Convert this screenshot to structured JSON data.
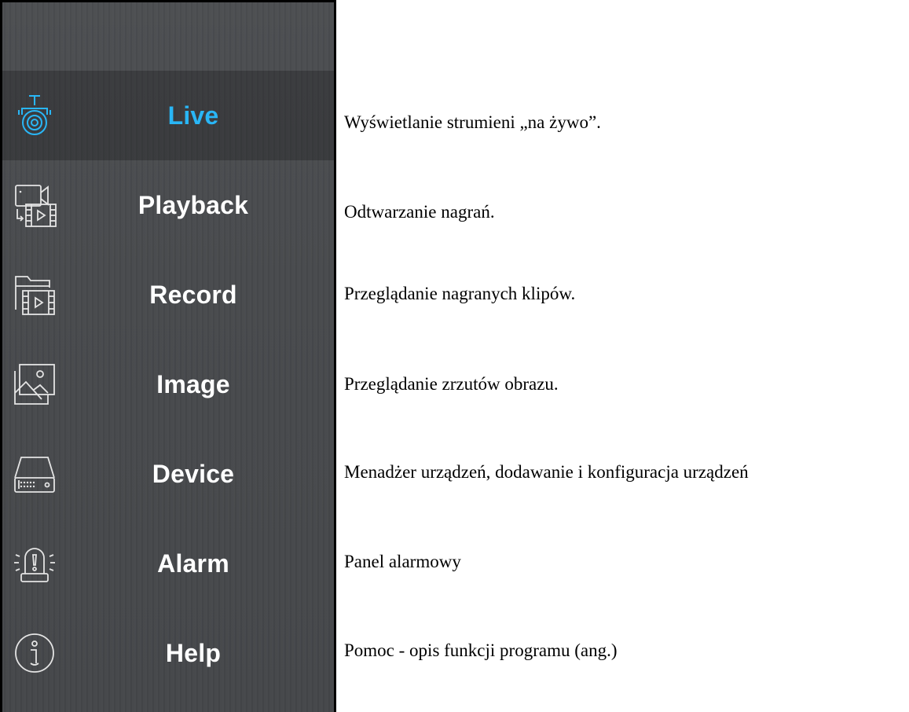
{
  "menu": {
    "items": [
      {
        "label": "Live",
        "icon": "camera-icon",
        "active": true
      },
      {
        "label": "Playback",
        "icon": "playback-icon",
        "active": false
      },
      {
        "label": "Record",
        "icon": "record-folder-icon",
        "active": false
      },
      {
        "label": "Image",
        "icon": "image-icon",
        "active": false
      },
      {
        "label": "Device",
        "icon": "device-icon",
        "active": false
      },
      {
        "label": "Alarm",
        "icon": "alarm-icon",
        "active": false
      },
      {
        "label": "Help",
        "icon": "help-icon",
        "active": false
      }
    ]
  },
  "descriptions": [
    "Wyświetlanie strumieni „na żywo”.",
    "Odtwarzanie nagrań.",
    "Przeglądanie nagranych klipów.",
    "Przeglądanie zrzutów obrazu.",
    "Menadżer urządzeń, dodawanie i konfiguracja urządzeń",
    "Panel alarmowy",
    "Pomoc - opis funkcji programu (ang.)"
  ],
  "colors": {
    "active_accent": "#29b6f6",
    "panel_bg": "#47494c",
    "icon_stroke": "#e4e4e4"
  }
}
